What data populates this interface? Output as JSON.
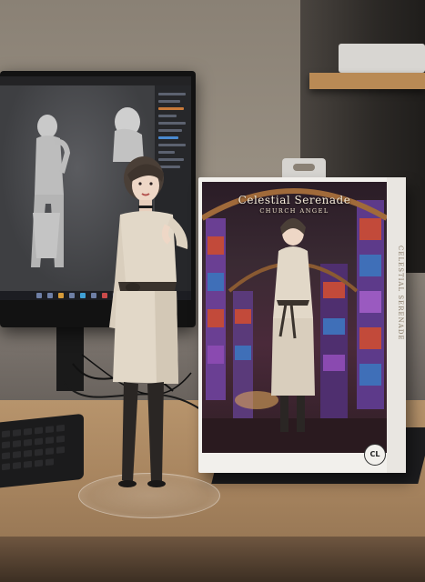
{
  "scene": {
    "description_label": "Photo"
  },
  "box": {
    "title": "Celestial Serenade",
    "subtitle": "CHURCH ANGEL",
    "spine_text": "CELESTIAL SERENADE",
    "logo": "CL"
  },
  "colors": {
    "dress": "#e2d8c8",
    "dress_shadow": "#b9ae9d",
    "sash": "#3a332d",
    "legs": "#2a2624",
    "hair": "#4a3f37",
    "skin": "#eed7c6",
    "stained_glass_a": "#7b3f9c",
    "stained_glass_b": "#c24a3a",
    "stained_glass_c": "#3f6fb8"
  },
  "icons": [
    "monitor",
    "keyboard",
    "figurine",
    "product-box",
    "logo-badge"
  ]
}
